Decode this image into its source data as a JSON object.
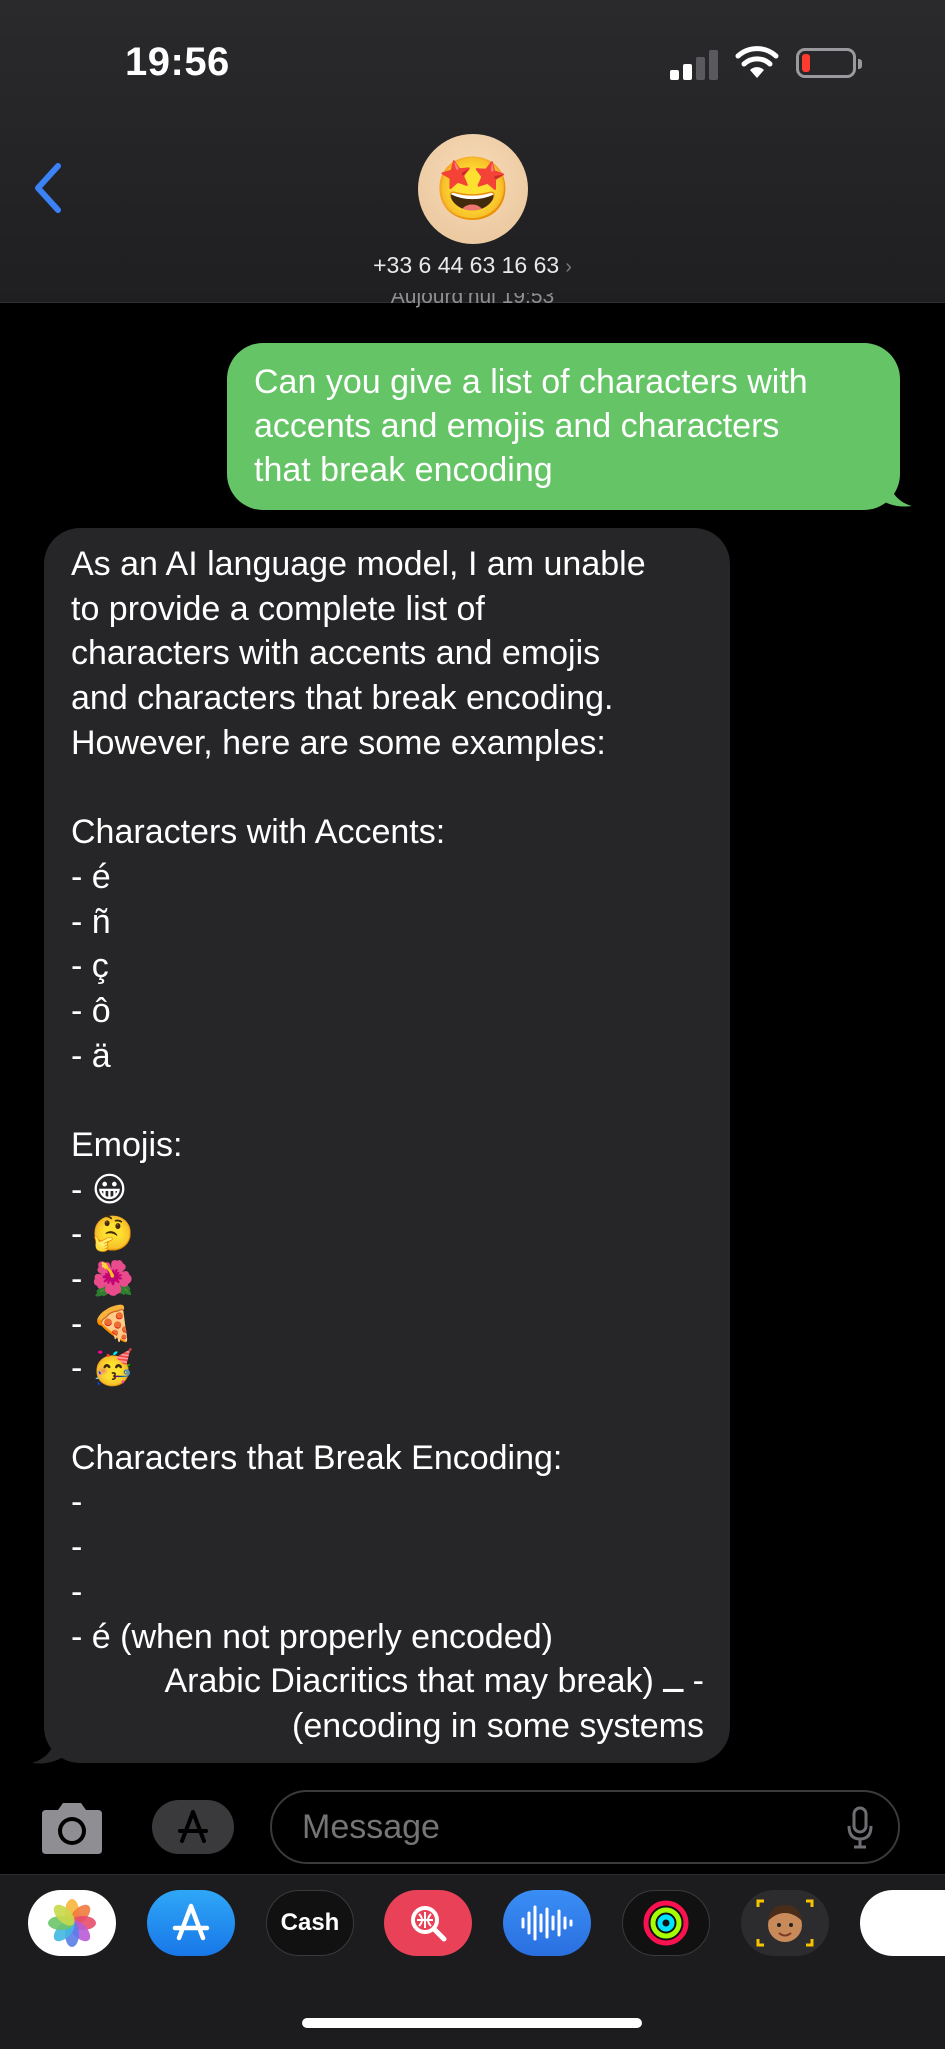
{
  "status_bar": {
    "time": "19:56"
  },
  "header": {
    "contact": "+33 6 44 63 16 63",
    "contact_chevron": "›",
    "avatar_emoji": "🤩"
  },
  "timestamp": "Aujourd’hui 19:53",
  "messages": {
    "outgoing": {
      "lines": [
        "Can you give a list of characters with",
        "accents and emojis and characters",
        "that break encoding"
      ]
    },
    "incoming": {
      "lines": [
        "As an AI language model, I am unable",
        "to provide a complete list of",
        "characters with accents and emojis",
        "and characters that break encoding.",
        "However, here are some examples:",
        "",
        "Characters with Accents:",
        "- é",
        "- ñ",
        "- ç",
        "- ô",
        "- ä",
        "",
        "Emojis:",
        "- 😀",
        "- 🤔",
        "- 🌺",
        "- 🍕",
        "- 🥳",
        "",
        "Characters that Break Encoding:",
        "-",
        "-",
        "-",
        "- é (when not properly encoded)",
        "Arabic Diacritics that may break) ــ -",
        "(encoding in some systems"
      ]
    }
  },
  "composer": {
    "placeholder": "Message"
  },
  "apps": {
    "cash_label": "Cash",
    "cash_symbol": "",
    "app_store_glyph": "A"
  },
  "colors": {
    "outgoing_bubble": "#65c466",
    "incoming_bubble": "#262628",
    "accent": "#3b82f6"
  },
  "icons": [
    "back-chevron-icon",
    "signal-icon",
    "wifi-icon",
    "battery-icon",
    "camera-icon",
    "app-store-icon",
    "mic-icon",
    "photos-icon",
    "apple-cash-icon",
    "images-search-icon",
    "audio-message-icon",
    "fitness-rings-icon",
    "memoji-icon"
  ]
}
